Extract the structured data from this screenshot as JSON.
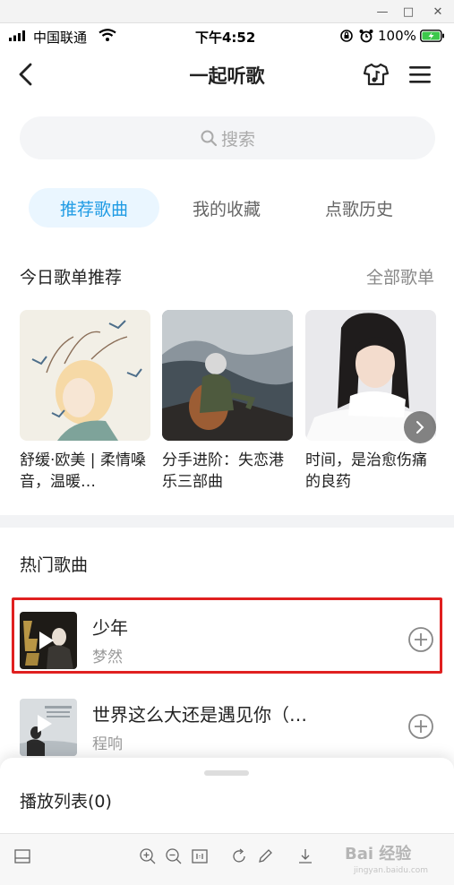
{
  "status_bar": {
    "carrier": "中国联通",
    "time": "下午4:52",
    "battery": "100%"
  },
  "header": {
    "title": "一起听歌"
  },
  "search": {
    "placeholder": "搜索"
  },
  "tabs": [
    {
      "label": "推荐歌曲",
      "active": true
    },
    {
      "label": "我的收藏",
      "active": false
    },
    {
      "label": "点歌历史",
      "active": false
    }
  ],
  "playlists_section": {
    "title": "今日歌单推荐",
    "more": "全部歌单",
    "items": [
      {
        "name": "舒缓·欧美 | 柔情嗓音，温暖…"
      },
      {
        "name": "分手进阶：失恋港乐三部曲"
      },
      {
        "name": "时间，是治愈伤痛的良药"
      }
    ]
  },
  "hot_section": {
    "title": "热门歌曲",
    "songs": [
      {
        "title": "少年",
        "artist": "梦然"
      },
      {
        "title": "世界这么大还是遇见你（…",
        "artist": "程响"
      }
    ]
  },
  "playlist_sheet": {
    "title": "播放列表(0)"
  },
  "watermark": {
    "text": "Bai 经验",
    "sub": "jingyan.baidu.com"
  },
  "colors": {
    "accent": "#1f9be4",
    "tab_active_bg": "#eaf6ff",
    "highlight": "#e02020"
  }
}
